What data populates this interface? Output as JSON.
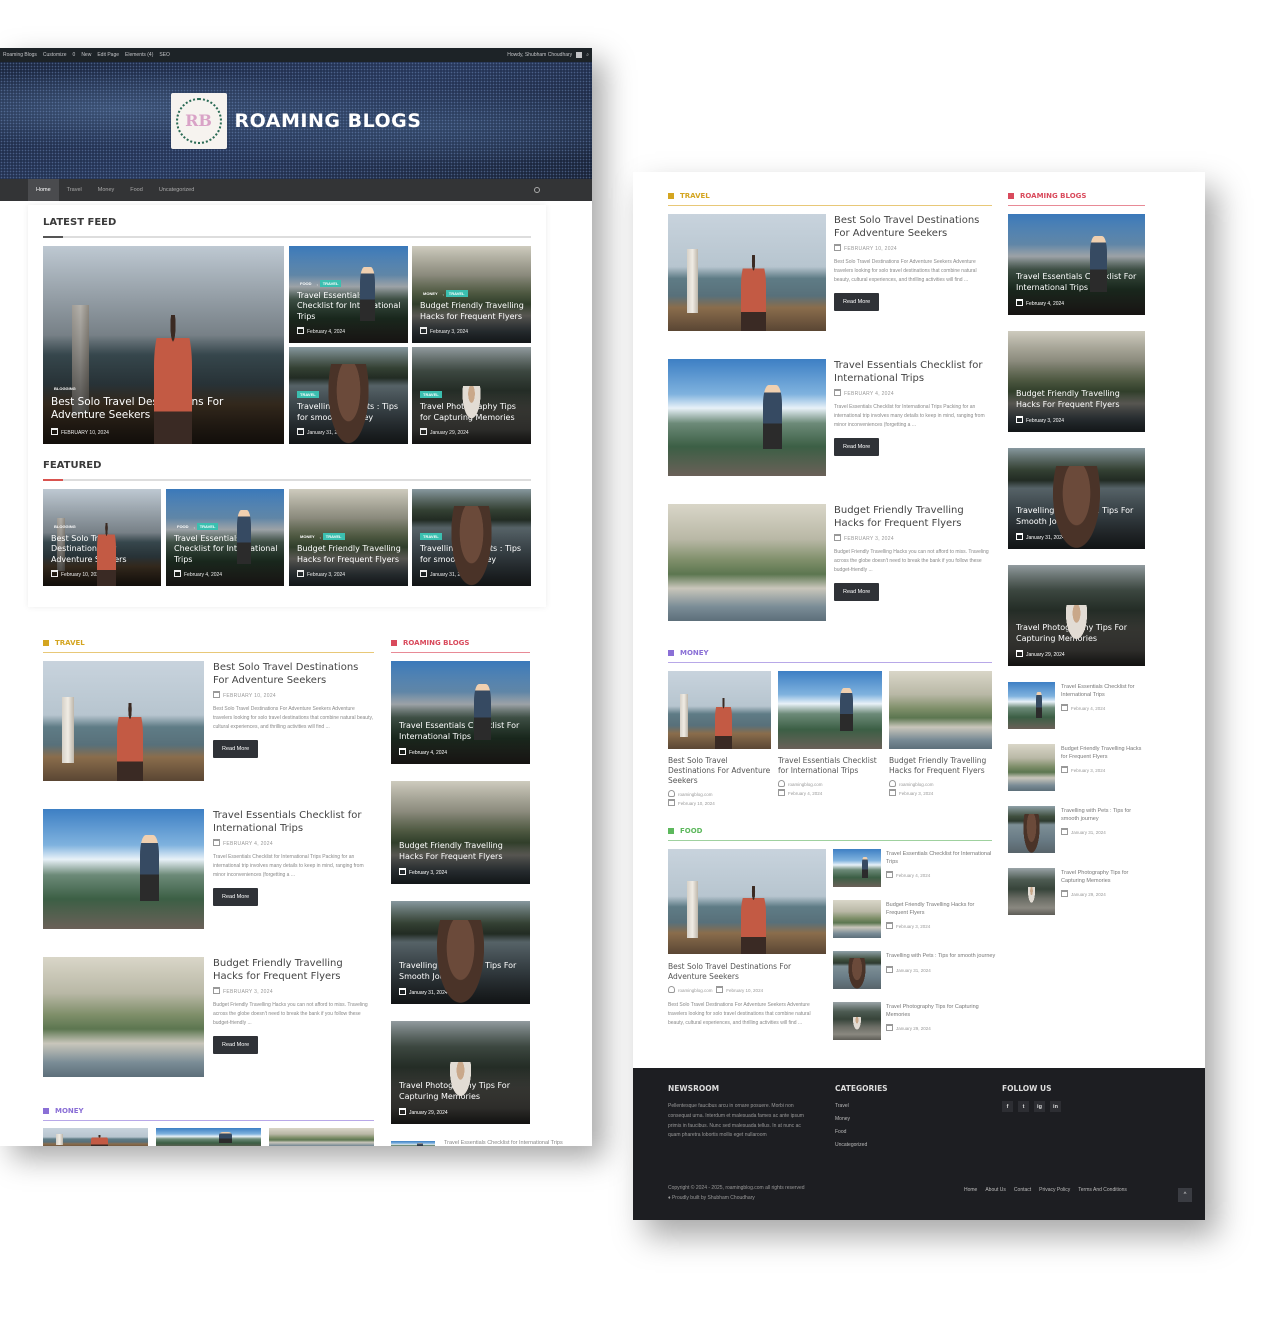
{
  "admin_bar": {
    "items": [
      "Roaming Blogs",
      "Customize",
      "0",
      "New",
      "Edit Page",
      "Elements (4)",
      "SEO"
    ],
    "greeting": "Howdy, Shubham Choudhary"
  },
  "site": {
    "title": "ROAMING BLOGS",
    "logo_letters": "RB",
    "logo_ring_text": "ROAMING BLOG · TRAVEL · FOOD · MONEY"
  },
  "nav": {
    "items": [
      {
        "label": "Home",
        "active": true
      },
      {
        "label": "Travel",
        "active": false
      },
      {
        "label": "Money",
        "active": false
      },
      {
        "label": "Food",
        "active": false
      },
      {
        "label": "Uncategorized",
        "active": false
      }
    ]
  },
  "latest_feed": {
    "heading": "LATEST FEED",
    "main": {
      "tags": [
        "BLOGGING"
      ],
      "title": "Best Solo Travel Destinations For Adventure Seekers",
      "date": "FEBRUARY 10, 2024"
    },
    "grid": [
      {
        "tags": [
          "FOOD",
          "TRAVEL"
        ],
        "title": "Travel Essentials Checklist for International Trips",
        "date": "February 4, 2024"
      },
      {
        "tags": [
          "MONEY",
          "TRAVEL"
        ],
        "title": "Budget Friendly Travelling Hacks for Frequent Flyers",
        "date": "February 3, 2024"
      },
      {
        "tags": [
          "TRAVEL"
        ],
        "title": "Travelling with Pets : Tips for smooth journey",
        "date": "January 31, 2024"
      },
      {
        "tags": [
          "TRAVEL"
        ],
        "title": "Travel Photography Tips for Capturing Memories",
        "date": "January 29, 2024"
      }
    ]
  },
  "featured": {
    "heading": "FEATURED",
    "items": [
      {
        "tags": [
          "BLOGGING"
        ],
        "title": "Best Solo Travel Destinations For Adventure Seekers",
        "date": "February 10, 2024"
      },
      {
        "tags": [
          "FOOD",
          "TRAVEL"
        ],
        "title": "Travel Essentials Checklist for International Trips",
        "date": "February 4, 2024"
      },
      {
        "tags": [
          "MONEY",
          "TRAVEL"
        ],
        "title": "Budget Friendly Travelling Hacks for Frequent Flyers",
        "date": "February 3, 2024"
      },
      {
        "tags": [
          "TRAVEL"
        ],
        "title": "Travelling with Pets : Tips for smooth journey",
        "date": "January 31, 2024"
      }
    ]
  },
  "travel_section": {
    "heading": "TRAVEL",
    "color": "#d4a520",
    "read_more": "Read More",
    "posts": [
      {
        "title": "Best Solo Travel Destinations For Adventure Seekers",
        "date": "FEBRUARY 10, 2024",
        "excerpt": "Best Solo Travel Destinations For Adventure Seekers Adventure travelers looking for solo travel destinations that combine natural beauty, cultural experiences, and thrilling activities will find ..."
      },
      {
        "title": "Travel Essentials Checklist for International Trips",
        "date": "FEBRUARY 4, 2024",
        "excerpt": "Travel Essentials Checklist for International Trips Packing for an international trip involves many details to keep in mind, ranging from minor inconveniences (forgetting a ..."
      },
      {
        "title": "Budget Friendly Travelling Hacks for Frequent Flyers",
        "date": "FEBRUARY 3, 2024",
        "excerpt": "Budget Friendly Travelling Hacks you can not afford to miss. Traveling across the globe doesn't need to break the bank if you follow these budget-friendly ..."
      }
    ]
  },
  "roaming_sidebar": {
    "heading": "ROAMING BLOGS",
    "color": "#d94a5c",
    "tiles": [
      {
        "title": "Travel Essentials Checklist For International Trips",
        "date": "February 4, 2024"
      },
      {
        "title": "Budget Friendly Travelling Hacks For Frequent Flyers",
        "date": "February 3, 2024"
      },
      {
        "title": "Travelling With Pets : Tips For Smooth Journey",
        "date": "January 31, 2024"
      },
      {
        "title": "Travel Photography Tips For Capturing Memories",
        "date": "January 29, 2024"
      }
    ],
    "small_list": [
      {
        "title": "Travel Essentials Checklist for International Trips",
        "date": "February 4, 2024"
      },
      {
        "title": "Budget Friendly Travelling Hacks for Frequent Flyers",
        "date": "February 3, 2024"
      },
      {
        "title": "Travelling with Pets : Tips for smooth journey",
        "date": "January 31, 2024"
      },
      {
        "title": "Travel Photography Tips for Capturing Memories",
        "date": "January 29, 2024"
      }
    ]
  },
  "money_section": {
    "heading": "MONEY",
    "color": "#8a6fd6",
    "posts": [
      {
        "title": "Best Solo Travel Destinations For Adventure Seekers",
        "author": "roamingblog.com",
        "date": "February 10, 2024"
      },
      {
        "title": "Travel Essentials Checklist for International Trips",
        "author": "roamingblog.com",
        "date": "February 4, 2024"
      },
      {
        "title": "Budget Friendly Travelling Hacks for Frequent Flyers",
        "author": "roamingblog.com",
        "date": "February 3, 2024"
      }
    ]
  },
  "food_section": {
    "heading": "FOOD",
    "color": "#5cb85c",
    "main": {
      "title": "Best Solo Travel Destinations For Adventure Seekers",
      "author": "roamingblog.com",
      "date": "February 10, 2024",
      "excerpt": "Best Solo Travel Destinations For Adventure Seekers Adventure travelers looking for solo travel destinations that combine natural beauty, cultural experiences, and thrilling activities will find ..."
    },
    "list": [
      {
        "title": "Travel Essentials Checklist for International Trips",
        "date": "February 4, 2024"
      },
      {
        "title": "Budget Friendly Travelling Hacks for Frequent Flyers",
        "date": "February 3, 2024"
      },
      {
        "title": "Travelling with Pets : Tips for smooth journey",
        "date": "January 31, 2024"
      },
      {
        "title": "Travel Photography Tips for Capturing Memories",
        "date": "January 29, 2024"
      }
    ]
  },
  "footer": {
    "newsroom_heading": "NEWSROOM",
    "newsroom_text": "Pellentesque faucibus arcu in ornare posuere. Morbi non consequat urna. Interdum et malesuada fames ac ante ipsum primis in faucibus. Nunc sed malesuada tellus. In at nunc ac quam pharetra lobortis mollis eget nullaroom",
    "categories_heading": "CATEGORIES",
    "categories": [
      "Travel",
      "Money",
      "Food",
      "Uncategorized"
    ],
    "follow_heading": "FOLLOW US",
    "social": [
      "f",
      "t",
      "ig",
      "in"
    ],
    "copyright": "Copyright © 2024 - 2025, roamingblog.com all rights reserved",
    "credit": "♦ Proudly built by Shubham Choudhary",
    "links": [
      "Home",
      "About Us",
      "Contact",
      "Privacy Policy",
      "Terms And Conditions"
    ],
    "back_to_top": "^"
  }
}
